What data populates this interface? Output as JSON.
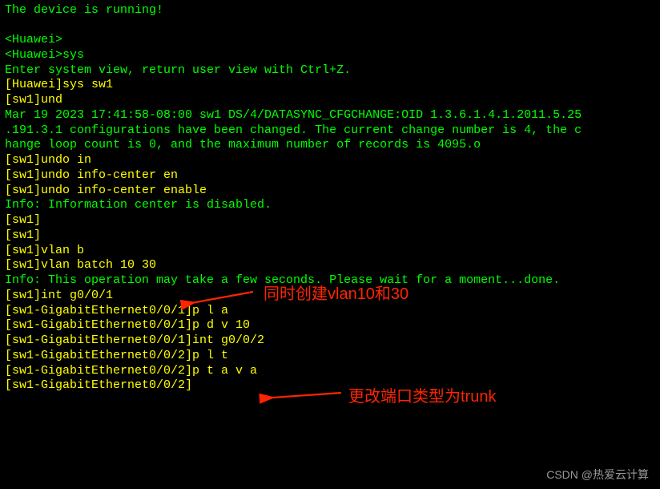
{
  "terminal": {
    "lines": [
      {
        "cls": "green",
        "text": "The device is running!"
      },
      {
        "cls": "green",
        "text": ""
      },
      {
        "cls": "green",
        "text": "<Huawei>"
      },
      {
        "cls": "green",
        "text": "<Huawei>sys"
      },
      {
        "cls": "green",
        "text": "Enter system view, return user view with Ctrl+Z."
      },
      {
        "cls": "yellow",
        "text": "[Huawei]sys sw1"
      },
      {
        "cls": "yellow",
        "text": "[sw1]und"
      },
      {
        "cls": "green",
        "text": "Mar 19 2023 17:41:58-08:00 sw1 DS/4/DATASYNC_CFGCHANGE:OID 1.3.6.1.4.1.2011.5.25"
      },
      {
        "cls": "green",
        "text": ".191.3.1 configurations have been changed. The current change number is 4, the c"
      },
      {
        "cls": "green",
        "text": "hange loop count is 0, and the maximum number of records is 4095.o"
      },
      {
        "cls": "yellow",
        "text": "[sw1]undo in"
      },
      {
        "cls": "yellow",
        "text": "[sw1]undo info-center en"
      },
      {
        "cls": "yellow",
        "text": "[sw1]undo info-center enable"
      },
      {
        "cls": "green",
        "text": "Info: Information center is disabled."
      },
      {
        "cls": "yellow",
        "text": "[sw1]"
      },
      {
        "cls": "yellow",
        "text": "[sw1]"
      },
      {
        "cls": "yellow",
        "text": "[sw1]vlan b"
      },
      {
        "cls": "yellow",
        "text": "[sw1]vlan batch 10 30"
      },
      {
        "cls": "green",
        "text": "Info: This operation may take a few seconds. Please wait for a moment...done."
      },
      {
        "cls": "yellow",
        "text": "[sw1]int g0/0/1"
      },
      {
        "cls": "yellow",
        "text": "[sw1-GigabitEthernet0/0/1]p l a"
      },
      {
        "cls": "yellow",
        "text": "[sw1-GigabitEthernet0/0/1]p d v 10"
      },
      {
        "cls": "yellow",
        "text": "[sw1-GigabitEthernet0/0/1]int g0/0/2"
      },
      {
        "cls": "yellow",
        "text": "[sw1-GigabitEthernet0/0/2]p l t"
      },
      {
        "cls": "yellow",
        "text": "[sw1-GigabitEthernet0/0/2]p t a v a"
      },
      {
        "cls": "yellow",
        "text": "[sw1-GigabitEthernet0/0/2]"
      }
    ]
  },
  "annotations": {
    "a1": "同时创建vlan10和30",
    "a2": "更改端口类型为trunk"
  },
  "watermark": "CSDN @热爱云计算"
}
